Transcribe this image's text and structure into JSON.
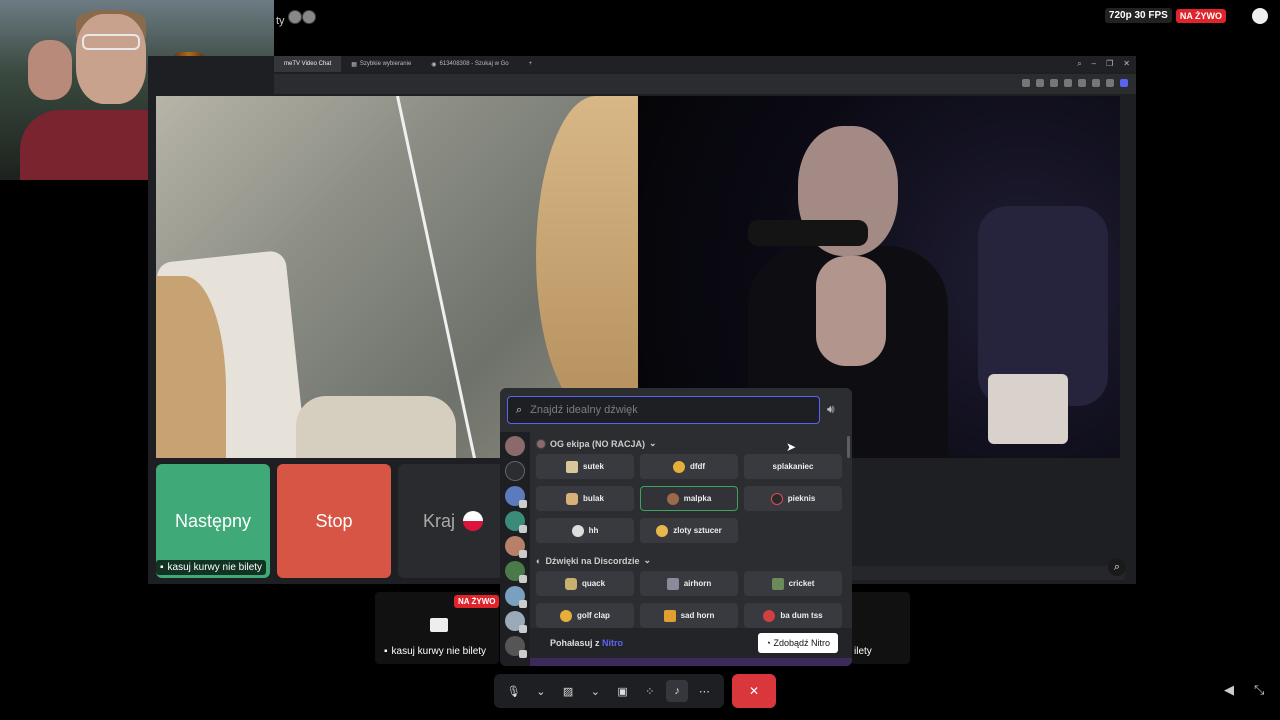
{
  "stream": {
    "resolution_badge": "720p 30 FPS",
    "live_badge": "NA ŻYWO",
    "title_fragment": "ty"
  },
  "browser": {
    "tabs": [
      {
        "label": "meTV Video Chat"
      },
      {
        "label": "Szybkie wybieranie"
      },
      {
        "label": "613408308 - Szukaj w Go"
      }
    ],
    "new_tab": "+"
  },
  "ome": {
    "next_button": "Następny",
    "stop_button": "Stop",
    "country_button": "Kraj",
    "caption": "kasuj kurwy nie bilety"
  },
  "participants": {
    "left_caption": "kasuj kurwy nie bilety",
    "left_live_badge": "NA ŻYWO",
    "right_caption": "ilety"
  },
  "soundboard": {
    "search_placeholder": "Znajdź idealny dźwięk",
    "sections": [
      {
        "title": "OG ekipa (NO RACJA)",
        "sounds": [
          "sutek",
          "dfdf",
          "splakaniec",
          "bulak",
          "malpka",
          "pieknis",
          "hh",
          "zloty sztucer"
        ]
      },
      {
        "title": "Dźwięki na Discordzie",
        "sounds": [
          "quack",
          "airhorn",
          "cricket",
          "golf clap",
          "sad horn",
          "ba dum tss"
        ]
      }
    ],
    "promo_text": "Pohałasuj z",
    "promo_nitro": "Nitro",
    "promo_button": "Zdobądź Nitro"
  },
  "colors": {
    "next_green": "#3fa978",
    "stop_red": "#d65545",
    "end_call_red": "#da373c",
    "live_red": "#e0242b",
    "discord_blurple": "#5865f2"
  }
}
